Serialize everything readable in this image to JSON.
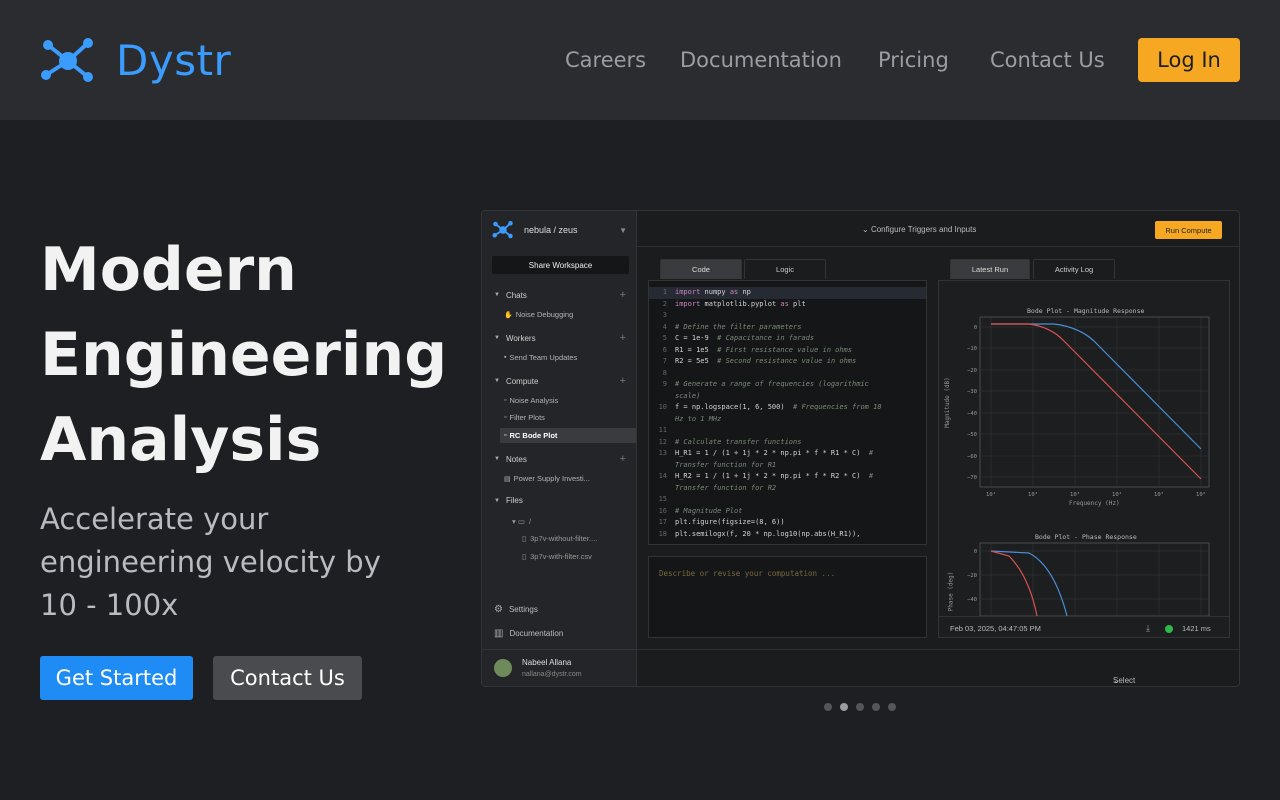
{
  "brand": {
    "name": "Dystr",
    "color": "#3b9cff"
  },
  "nav": {
    "items": [
      "Careers",
      "Documentation",
      "Pricing",
      "Contact Us"
    ],
    "login": "Log In"
  },
  "hero": {
    "title_lines": [
      "Modern",
      "Engineering",
      "Analysis"
    ],
    "subtitle": "Accelerate your engineering velocity by 10 - 100x",
    "primary_cta": "Get Started",
    "secondary_cta": "Contact Us"
  },
  "app": {
    "workspace": "nebula / zeus",
    "share_button": "Share Workspace",
    "sections": {
      "chats": {
        "label": "Chats",
        "items": [
          "Noise Debugging"
        ]
      },
      "workers": {
        "label": "Workers",
        "items": [
          "Send Team Updates"
        ]
      },
      "compute": {
        "label": "Compute",
        "items": [
          "Noise Analysis",
          "Filter Plots",
          "RC Bode Plot"
        ]
      },
      "notes": {
        "label": "Notes",
        "items": [
          "Power Supply Investi..."
        ]
      },
      "files": {
        "label": "Files",
        "folder": "/",
        "items": [
          "3p7v-without-filter....",
          "3p7v-with-filter.csv"
        ]
      }
    },
    "settings": "Settings",
    "documentation": "Documentation",
    "user": {
      "name": "Nabeel Allana",
      "email": "nallana@dystr.com"
    },
    "configure": "Configure Triggers and Inputs",
    "run_button": "Run Compute",
    "code_tabs": [
      "Code",
      "Logic"
    ],
    "result_tabs": [
      "Latest Run",
      "Activity Log"
    ],
    "prompt_placeholder": "Describe or revise your computation ...",
    "plot1_title": "Bode Plot - Magnitude Response",
    "plot1_xlabel": "Frequency (Hz)",
    "plot1_ylabel": "Magnitude (dB)",
    "plot2_title": "Bode Plot - Phase Response",
    "plot2_ylabel": "Phase (deg)",
    "run_time": "Feb 03, 2025, 04:47:05 PM",
    "duration": "1421 ms",
    "post_run": "Select Post Run Actions"
  },
  "colors": {
    "accent": "#f7a823",
    "primary": "#1f8cf5",
    "series_blue": "#4a90d9",
    "series_red": "#d9534f"
  },
  "carousel": {
    "count": 5,
    "active": 1
  }
}
